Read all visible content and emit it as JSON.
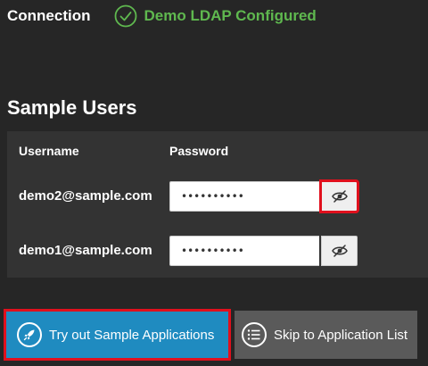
{
  "connection": {
    "label": "Connection",
    "status_text": "Demo LDAP Configured",
    "status_icon": "check-circle-icon",
    "status_color": "#5fb84f"
  },
  "sample_users": {
    "title": "Sample Users",
    "columns": {
      "username": "Username",
      "password": "Password"
    },
    "rows": [
      {
        "username": "demo2@sample.com",
        "password_masked": "••••••••••",
        "toggle_icon": "eye-slash-icon",
        "highlighted": true
      },
      {
        "username": "demo1@sample.com",
        "password_masked": "••••••••••",
        "toggle_icon": "eye-slash-icon",
        "highlighted": false
      }
    ]
  },
  "actions": {
    "try_label": "Try out Sample Applications",
    "try_icon": "rocket-icon",
    "skip_label": "Skip to Application List",
    "skip_icon": "list-icon",
    "primary_color": "#1f8bc0",
    "secondary_color": "#5a5a5a",
    "highlight_color": "#e0101d"
  }
}
